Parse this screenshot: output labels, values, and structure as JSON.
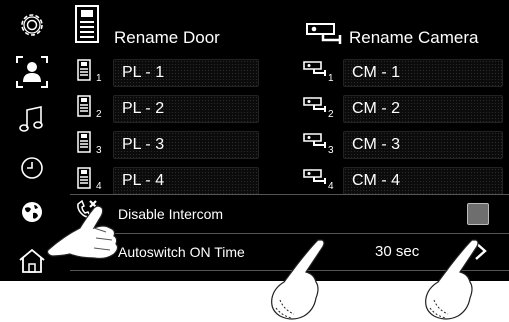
{
  "colors": {
    "screen_bg": "#000000",
    "text": "#ffffff",
    "field_bg": "#0b0b0b",
    "separator": "#555555",
    "checkbox_fill": "#6e6e6e"
  },
  "sidebar": {
    "items": [
      {
        "name": "settings",
        "icon": "gear-icon"
      },
      {
        "name": "user",
        "icon": "user-icon",
        "selected": true
      },
      {
        "name": "music",
        "icon": "music-note-icon"
      },
      {
        "name": "clock",
        "icon": "clock-icon"
      },
      {
        "name": "globe",
        "icon": "globe-icon"
      },
      {
        "name": "home",
        "icon": "home-icon"
      }
    ]
  },
  "headers": {
    "door": "Rename Door",
    "camera": "Rename Camera"
  },
  "doors": [
    {
      "num": "1",
      "name": "PL - 1"
    },
    {
      "num": "2",
      "name": "PL - 2"
    },
    {
      "num": "3",
      "name": "PL - 3"
    },
    {
      "num": "4",
      "name": "PL - 4"
    }
  ],
  "cameras": [
    {
      "num": "1",
      "name": "CM - 1"
    },
    {
      "num": "2",
      "name": "CM - 2"
    },
    {
      "num": "3",
      "name": "CM - 3"
    },
    {
      "num": "4",
      "name": "CM - 4"
    }
  ],
  "disable_intercom": {
    "label": "Disable Intercom",
    "checked": false
  },
  "autoswitch": {
    "label": "Autoswitch ON Time",
    "value": "30 sec"
  }
}
